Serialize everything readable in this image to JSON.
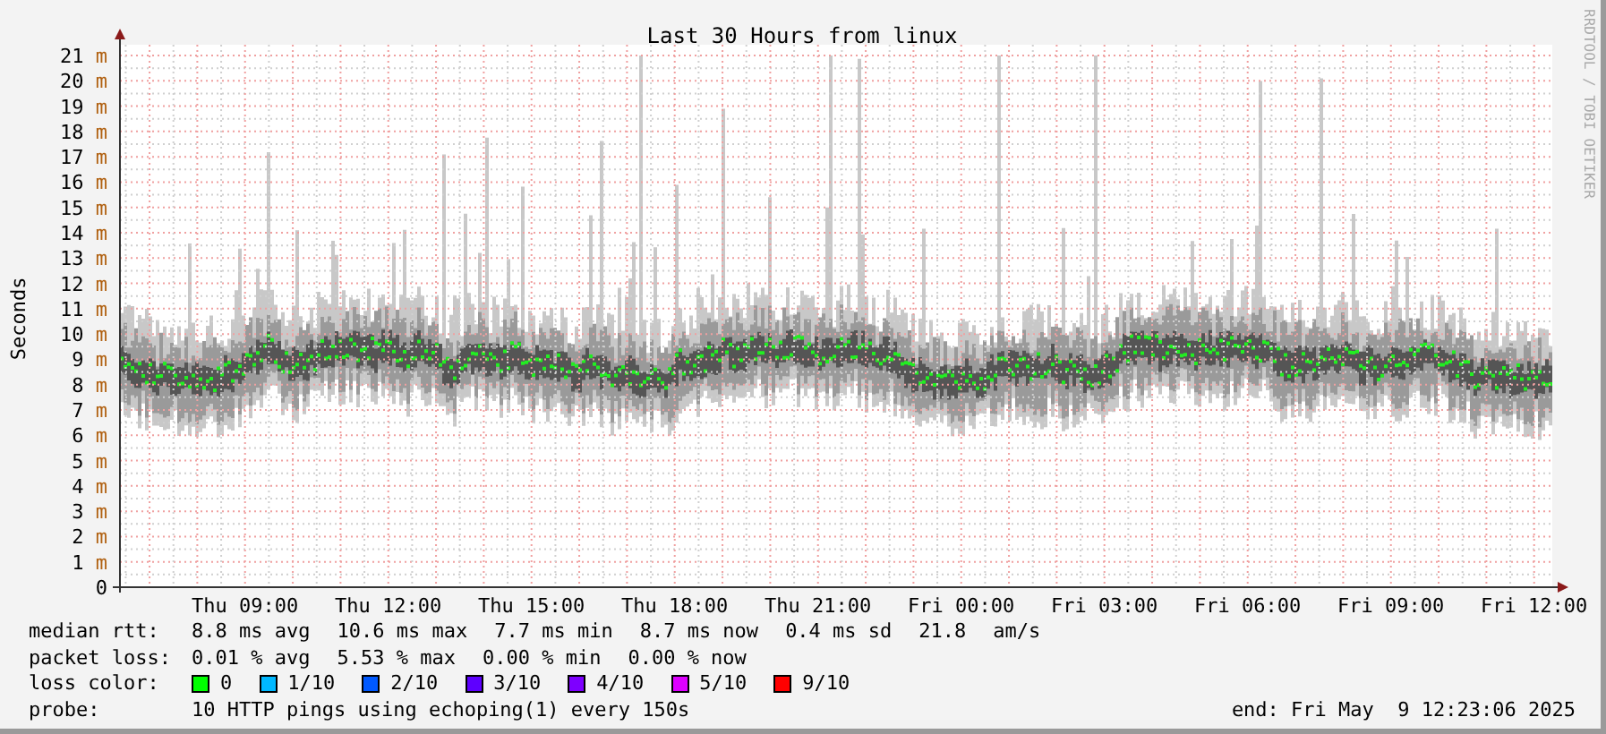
{
  "graph": {
    "side_label": "RRDTOOL / TOBI OETIKER",
    "chart_data": {
      "type": "area",
      "grid": true,
      "categories": [
        null,
        null,
        "Thu 09:00",
        null,
        null,
        "Thu 12:00",
        null,
        null,
        "Thu 15:00",
        null,
        null,
        "Thu 18:00",
        null,
        null,
        "Thu 21:00",
        null,
        null,
        "Fri 00:00",
        null,
        null,
        "Fri 03:00",
        null,
        null,
        "Fri 06:00",
        null,
        null,
        "Fri 09:00",
        null,
        null,
        "Fri 12:00"
      ],
      "title": "Last 30 Hours from linux",
      "ylabel": "Seconds",
      "ylim": [
        0,
        21
      ],
      "yticks": [
        {
          "value": 0,
          "label": "0"
        },
        {
          "value": 1,
          "label": "1 m"
        },
        {
          "value": 2,
          "label": "2 m"
        },
        {
          "value": 3,
          "label": "3 m"
        },
        {
          "value": 4,
          "label": "4 m"
        },
        {
          "value": 5,
          "label": "5 m"
        },
        {
          "value": 6,
          "label": "6 m"
        },
        {
          "value": 7,
          "label": "7 m"
        },
        {
          "value": 8,
          "label": "8 m"
        },
        {
          "value": 9,
          "label": "9 m"
        },
        {
          "value": 10,
          "label": "10 m"
        },
        {
          "value": 11,
          "label": "11 m"
        },
        {
          "value": 12,
          "label": "12 m"
        },
        {
          "value": 13,
          "label": "13 m"
        },
        {
          "value": 14,
          "label": "14 m"
        },
        {
          "value": 15,
          "label": "15 m"
        },
        {
          "value": 16,
          "label": "16 m"
        },
        {
          "value": 17,
          "label": "17 m"
        },
        {
          "value": 18,
          "label": "18 m"
        },
        {
          "value": 19,
          "label": "19 m"
        },
        {
          "value": 20,
          "label": "20 m"
        },
        {
          "value": 21,
          "label": "21 m"
        }
      ]
    }
  },
  "legend": {
    "median_rtt": {
      "label": "median rtt:",
      "values": [
        "8.8 ms avg",
        "10.6 ms max",
        "7.7 ms min",
        "8.7 ms now",
        "0.4 ms sd",
        "21.8",
        "am/s"
      ]
    },
    "packet_loss": {
      "label": "packet loss:",
      "values": [
        "0.01 % avg",
        "5.53 % max",
        "0.00 % min",
        "0.00 % now"
      ]
    },
    "loss_color": {
      "label": "loss color:",
      "items": [
        {
          "label": "0",
          "color": "#00ff00"
        },
        {
          "label": "1/10",
          "color": "#00b8ff"
        },
        {
          "label": "2/10",
          "color": "#0059ff"
        },
        {
          "label": "3/10",
          "color": "#5e00ff"
        },
        {
          "label": "4/10",
          "color": "#7e00ff"
        },
        {
          "label": "5/10",
          "color": "#dd00ff"
        },
        {
          "label": "9/10",
          "color": "#ff0000"
        }
      ]
    },
    "probe": {
      "label": "probe:",
      "value": "10 HTTP pings using echoping(1) every 150s"
    },
    "end": "end: Fri May  9 12:23:06 2025"
  }
}
